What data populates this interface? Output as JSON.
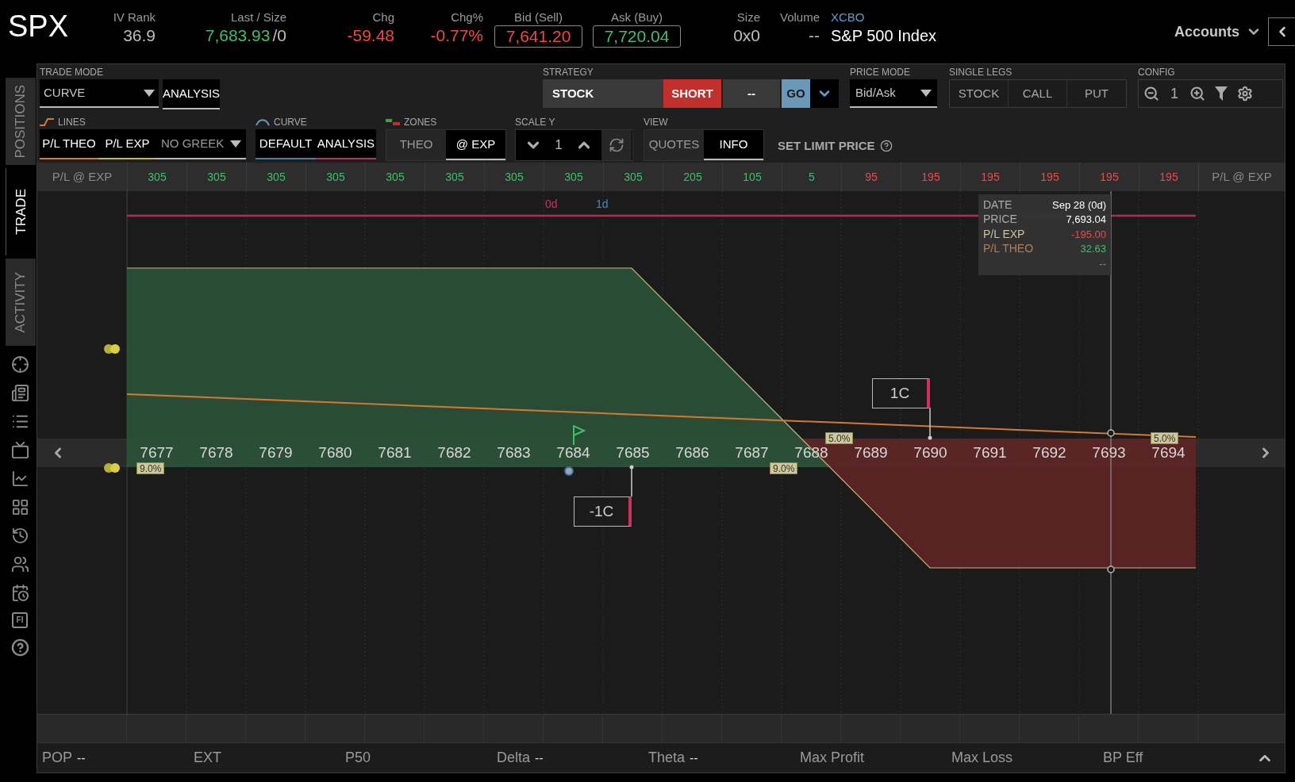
{
  "quote": {
    "symbol": "SPX",
    "fields": [
      {
        "kind": "plain",
        "label": "IV Rank",
        "value": "36.9"
      },
      {
        "kind": "gain",
        "label": "Last / Size",
        "value": "7,683.93",
        "size": "/0"
      },
      {
        "kind": "loss",
        "label": "Chg",
        "value": "-59.48"
      },
      {
        "kind": "loss",
        "label": "Chg%",
        "value": "-0.77%"
      },
      {
        "kind": "bid",
        "label": "Bid (Sell)",
        "value": "7,641.20"
      },
      {
        "kind": "ask",
        "label": "Ask (Buy)",
        "value": "7,720.04"
      },
      {
        "kind": "plain",
        "label": "Size",
        "value": "0x0"
      },
      {
        "kind": "plain",
        "label": "Volume",
        "value": "--"
      }
    ],
    "exchange": "XCBO",
    "description": "S&P 500 Index"
  },
  "accounts": "Accounts",
  "side_tabs": [
    {
      "label": "POSITIONS",
      "selected": false
    },
    {
      "label": "TRADE",
      "selected": true
    },
    {
      "label": "ACTIVITY",
      "selected": false
    }
  ],
  "sidebar_badge": "FI",
  "trade_mode": {
    "label": "TRADE MODE",
    "dropdown": "CURVE",
    "button": {
      "label": "ANALYSIS",
      "on": true
    }
  },
  "strategy": {
    "label": "STRATEGY",
    "stock": "STOCK",
    "side": "SHORT",
    "dash": "--",
    "go": "GO"
  },
  "price_mode": {
    "label": "PRICE MODE",
    "dropdown": "Bid/Ask"
  },
  "single_legs": {
    "label": "SINGLE LEGS",
    "buttons": [
      "STOCK",
      "CALL",
      "PUT"
    ]
  },
  "config": {
    "label": "CONFIG",
    "zoom": "1"
  },
  "lines": {
    "label": "LINES",
    "buttons": [
      {
        "label": "P/L THEO",
        "on": true,
        "color": "#d9782d"
      },
      {
        "label": "P/L EXP",
        "on": true,
        "color": "#c9b458"
      }
    ],
    "dropdown": "NO GREEK"
  },
  "curve": {
    "label": "CURVE",
    "buttons": [
      {
        "label": "DEFAULT",
        "on": true,
        "color": "#4f7f9f"
      },
      {
        "label": "ANALYSIS",
        "on": true,
        "color": "#b8365a"
      }
    ]
  },
  "zones": {
    "label": "ZONES",
    "buttons": [
      {
        "label": "THEO",
        "selected": false
      },
      {
        "label": "@ EXP",
        "selected": true
      }
    ]
  },
  "scale_y": {
    "label": "SCALE Y",
    "value": "1"
  },
  "view": {
    "label": "VIEW",
    "buttons": [
      {
        "label": "QUOTES",
        "selected": false
      },
      {
        "label": "INFO",
        "selected": true
      }
    ]
  },
  "set_limit_price": "SET LIMIT PRICE",
  "pl_row": {
    "label": "P/L @ EXP",
    "right_label": "P/L @ EXP",
    "values": [
      {
        "text": "305",
        "kind": "gain"
      },
      {
        "text": "305",
        "kind": "gain"
      },
      {
        "text": "305",
        "kind": "gain"
      },
      {
        "text": "305",
        "kind": "gain"
      },
      {
        "text": "305",
        "kind": "gain"
      },
      {
        "text": "305",
        "kind": "gain"
      },
      {
        "text": "305",
        "kind": "gain"
      },
      {
        "text": "305",
        "kind": "gain"
      },
      {
        "text": "305",
        "kind": "gain"
      },
      {
        "text": "205",
        "kind": "gain"
      },
      {
        "text": "105",
        "kind": "gain"
      },
      {
        "text": "5",
        "kind": "gain"
      },
      {
        "text": "95",
        "kind": "loss"
      },
      {
        "text": "195",
        "kind": "loss"
      },
      {
        "text": "195",
        "kind": "loss"
      },
      {
        "text": "195",
        "kind": "loss"
      },
      {
        "text": "195",
        "kind": "loss"
      },
      {
        "text": "195",
        "kind": "loss"
      }
    ]
  },
  "chart": {
    "curve_labels": [
      {
        "text": "0d",
        "color": "#c8345c"
      },
      {
        "text": "1d",
        "color": "#4a86c0"
      }
    ],
    "info": [
      {
        "kind": "date",
        "label": "DATE",
        "value": "Sep 28 (0d)"
      },
      {
        "kind": "price",
        "label": "PRICE",
        "value": "7,693.04"
      },
      {
        "kind": "exp",
        "label": "P/L EXP",
        "value": "-195.00"
      },
      {
        "kind": "theo",
        "label": "P/L THEO",
        "value": "32.63"
      },
      {
        "kind": "extra",
        "value": "--"
      }
    ],
    "prices": [
      "7677",
      "7678",
      "7679",
      "7680",
      "7681",
      "7682",
      "7683",
      "7684",
      "7685",
      "7686",
      "7687",
      "7688",
      "7689",
      "7690",
      "7691",
      "7692",
      "7693",
      "7694"
    ],
    "orders": [
      "1C",
      "-1C"
    ],
    "badges": [
      "9.0%",
      "9.0%",
      "5.0%",
      "5.0%"
    ]
  },
  "stats": [
    {
      "label": "POP",
      "value": "--"
    },
    {
      "label": "EXT"
    },
    {
      "label": "P50"
    },
    {
      "label": "Delta",
      "value": "--"
    },
    {
      "label": "Theta",
      "value": "--"
    },
    {
      "label": "Max Profit"
    },
    {
      "label": "Max Loss"
    },
    {
      "label": "BP Eff"
    }
  ]
}
